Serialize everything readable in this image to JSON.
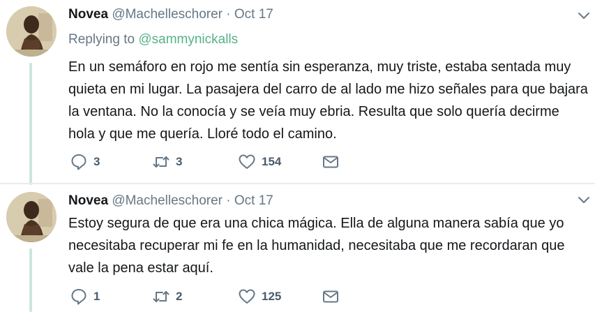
{
  "tweets": [
    {
      "name": "Novea",
      "handle": "@Machelleschorer",
      "separator": "·",
      "date": "Oct 17",
      "replying_prefix": "Replying to ",
      "replying_to": "@sammynickalls",
      "text": "En un semáforo en rojo me sentía sin esperanza, muy triste, estaba sentada muy quieta en mi lugar. La pasajera del carro de al lado me hizo señales para que bajara la ventana. No la conocía y se veía muy ebria. Resulta que solo quería decirme hola y que me quería. Lloré todo el camino.",
      "replies": "3",
      "retweets": "3",
      "likes": "154"
    },
    {
      "name": "Novea",
      "handle": "@Machelleschorer",
      "separator": "·",
      "date": "Oct 17",
      "text": "Estoy  segura de que era una chica mágica. Ella de alguna manera sabía que yo necesitaba recuperar mi fe en la humanidad, necesitaba que me recordaran que vale la pena estar aquí.",
      "replies": "1",
      "retweets": "2",
      "likes": "125"
    }
  ],
  "icons": {
    "reply": "reply-icon",
    "retweet": "retweet-icon",
    "like": "heart-icon",
    "dm": "envelope-icon",
    "more": "chevron-down-icon"
  },
  "colors": {
    "accent": "#57b287",
    "thread_line": "#cce6dc",
    "secondary_text": "#657786",
    "icon": "#657786"
  }
}
